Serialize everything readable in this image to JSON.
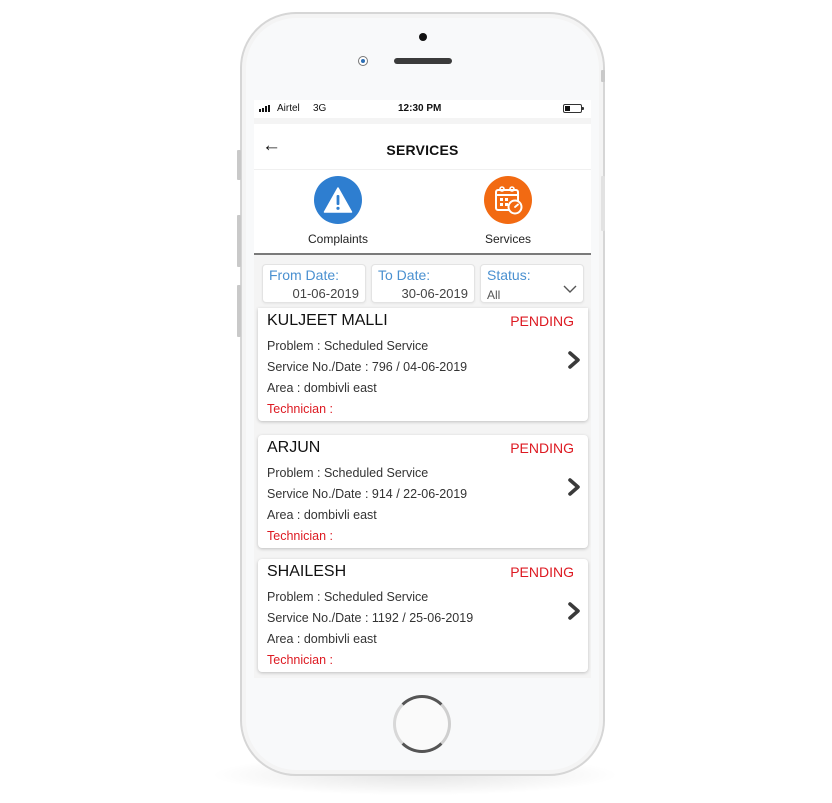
{
  "status_bar": {
    "carrier": "Airtel",
    "network": "3G",
    "time": "12:30 PM",
    "signal_icon": "signal-bars-icon",
    "battery_icon": "battery-low-icon"
  },
  "header": {
    "title": "SERVICES",
    "back_icon": "arrow-left-icon",
    "back_glyph": "←"
  },
  "tabs": [
    {
      "label": "Complaints",
      "icon": "warning-triangle-icon",
      "color": "#2e7ed0"
    },
    {
      "label": "Services",
      "icon": "calendar-clock-icon",
      "color": "#f26a12"
    }
  ],
  "filters": {
    "from_date": {
      "label": "From Date:",
      "value": "01-06-2019"
    },
    "to_date": {
      "label": "To Date:",
      "value": "30-06-2019"
    },
    "status": {
      "label": "Status:",
      "value": "All"
    }
  },
  "services": [
    {
      "name": "KULJEET MALLI",
      "status": "PENDING",
      "problem": "Problem : Scheduled Service",
      "service_no_date": "Service No./Date : 796 / 04-06-2019",
      "area": "Area : dombivli east",
      "technician": "Technician :"
    },
    {
      "name": "ARJUN",
      "status": "PENDING",
      "problem": "Problem : Scheduled Service",
      "service_no_date": "Service No./Date : 914 / 22-06-2019",
      "area": "Area : dombivli east",
      "technician": "Technician :"
    },
    {
      "name": "SHAILESH",
      "status": "PENDING",
      "problem": "Problem : Scheduled Service",
      "service_no_date": "Service No./Date : 1192 / 25-06-2019",
      "area": "Area : dombivli east",
      "technician": "Technician :"
    }
  ],
  "colors": {
    "accent_blue": "#4a90d0",
    "status_red": "#dd1a22",
    "complaints_blue": "#2e7ed0",
    "services_orange": "#f26a12"
  }
}
